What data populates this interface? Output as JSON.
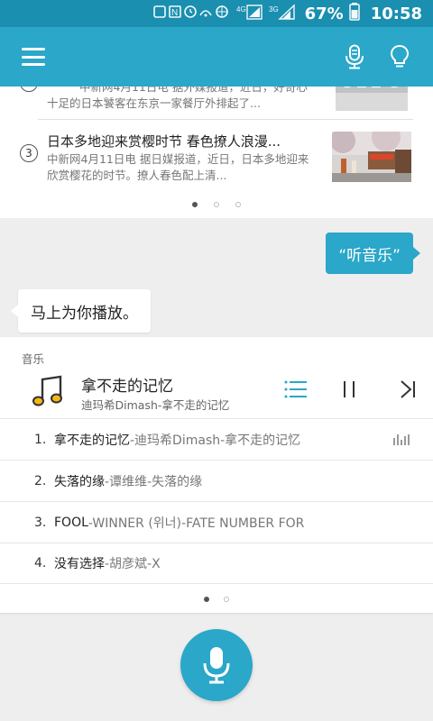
{
  "status_bar": {
    "battery": "67%",
    "time": "10:58",
    "net_4g": "4G",
    "net_3g": "3G"
  },
  "app_bar": {
    "icons": [
      "menu-icon",
      "microphone-icon",
      "lightbulb-icon"
    ]
  },
  "news": {
    "items": [
      {
        "num": "2",
        "title": "",
        "desc": "中新网4月11日电 据外媒报道，近日，好奇心十足的日本饕客在东京一家餐厅外排起了..."
      },
      {
        "num": "3",
        "title": "日本多地迎来赏樱时节 春色撩人浪漫...",
        "desc": "中新网4月11日电 据日媒报道，近日，日本多地迎来欣赏樱花的时节。撩人春色配上清..."
      }
    ],
    "page_count": 3,
    "active_page": 0
  },
  "chat": {
    "user_message": "“听音乐”",
    "bot_message": "马上为你播放。"
  },
  "music": {
    "category": "音乐",
    "now_playing": {
      "title": "拿不走的记忆",
      "subtitle": "迪玛希Dimash-拿不走的记忆"
    },
    "accent_color": "#2aa7c9",
    "tracks": [
      {
        "num": "1.",
        "name": "拿不走的记忆",
        "artist": " -迪玛希Dimash-拿不走的记忆",
        "playing": true
      },
      {
        "num": "2.",
        "name": "失落的缘",
        "artist": " -谭维维-失落的缘",
        "playing": false
      },
      {
        "num": "3.",
        "name": "FOOL",
        "artist": "-WINNER (위너)-FATE NUMBER FOR",
        "playing": false
      },
      {
        "num": "4.",
        "name": "没有选择",
        "artist": "-胡彦斌-X",
        "playing": false
      }
    ],
    "page_count": 2,
    "active_page": 0
  }
}
